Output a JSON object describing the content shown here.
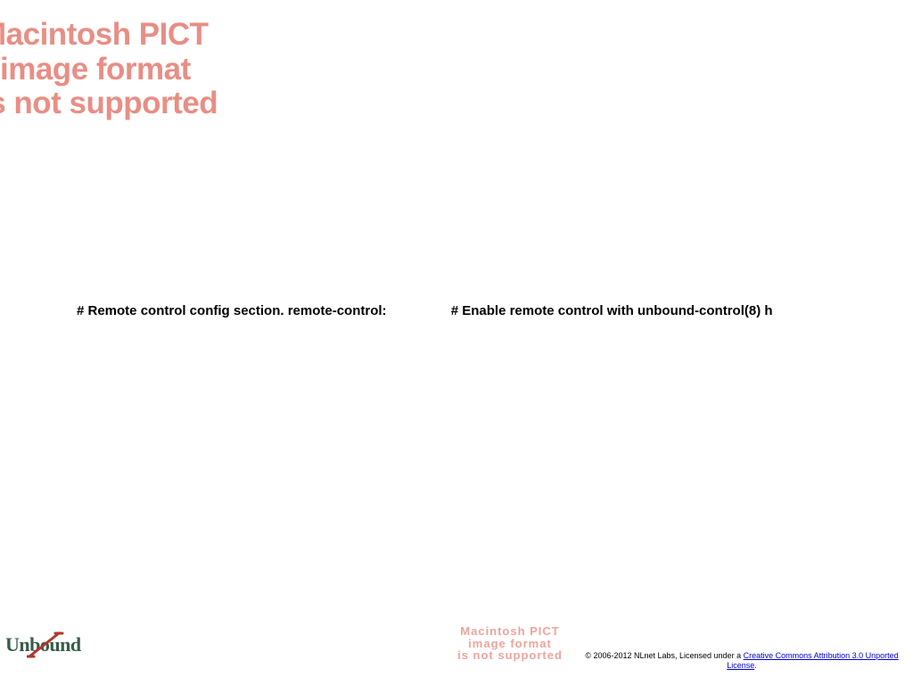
{
  "pict_placeholder": {
    "line1": "Macintosh PICT",
    "line2": "image format",
    "line3": "is not supported"
  },
  "code_row": {
    "left": "# Remote control config section. remote-control:",
    "right": "# Enable remote control with unbound-control(8) h"
  },
  "logo": {
    "text": "Unbound"
  },
  "pict_small": {
    "line1": "Macintosh PICT",
    "line2": "image format",
    "line3": "is not supported"
  },
  "license": {
    "prefix": "© 2006-2012 NLnet Labs, Licensed under a ",
    "link_text": "Creative Commons Attribution 3.0 Unported License",
    "suffix": "."
  }
}
